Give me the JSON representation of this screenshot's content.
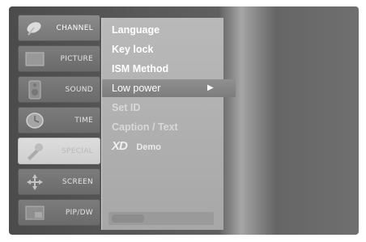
{
  "sidebar": {
    "items": [
      {
        "label": "CHANNEL",
        "icon": "satellite-dish-icon",
        "state": "active"
      },
      {
        "label": "PICTURE",
        "icon": "picture-icon",
        "state": "normal"
      },
      {
        "label": "SOUND",
        "icon": "speaker-icon",
        "state": "normal"
      },
      {
        "label": "TIME",
        "icon": "clock-icon",
        "state": "normal"
      },
      {
        "label": "SPECIAL",
        "icon": "tool-icon",
        "state": "highlighted"
      },
      {
        "label": "SCREEN",
        "icon": "screen-arrows-icon",
        "state": "normal"
      },
      {
        "label": "PIP/DW",
        "icon": "pip-icon",
        "state": "normal"
      }
    ]
  },
  "submenu": {
    "items": [
      {
        "label": "Language",
        "state": "enabled"
      },
      {
        "label": "Key lock",
        "state": "enabled"
      },
      {
        "label": "ISM Method",
        "state": "enabled"
      },
      {
        "label": "Low power",
        "state": "selected",
        "arrow": "▶"
      },
      {
        "label": "Set ID",
        "state": "disabled"
      },
      {
        "label": "Caption / Text",
        "state": "disabled"
      }
    ],
    "xd_demo": {
      "logo": "XD",
      "label": "Demo"
    }
  },
  "colors": {
    "panel": "#b0b0b0",
    "selected_row": "#858585",
    "text": "#ffffff",
    "disabled_text": "#d8d8d8"
  }
}
